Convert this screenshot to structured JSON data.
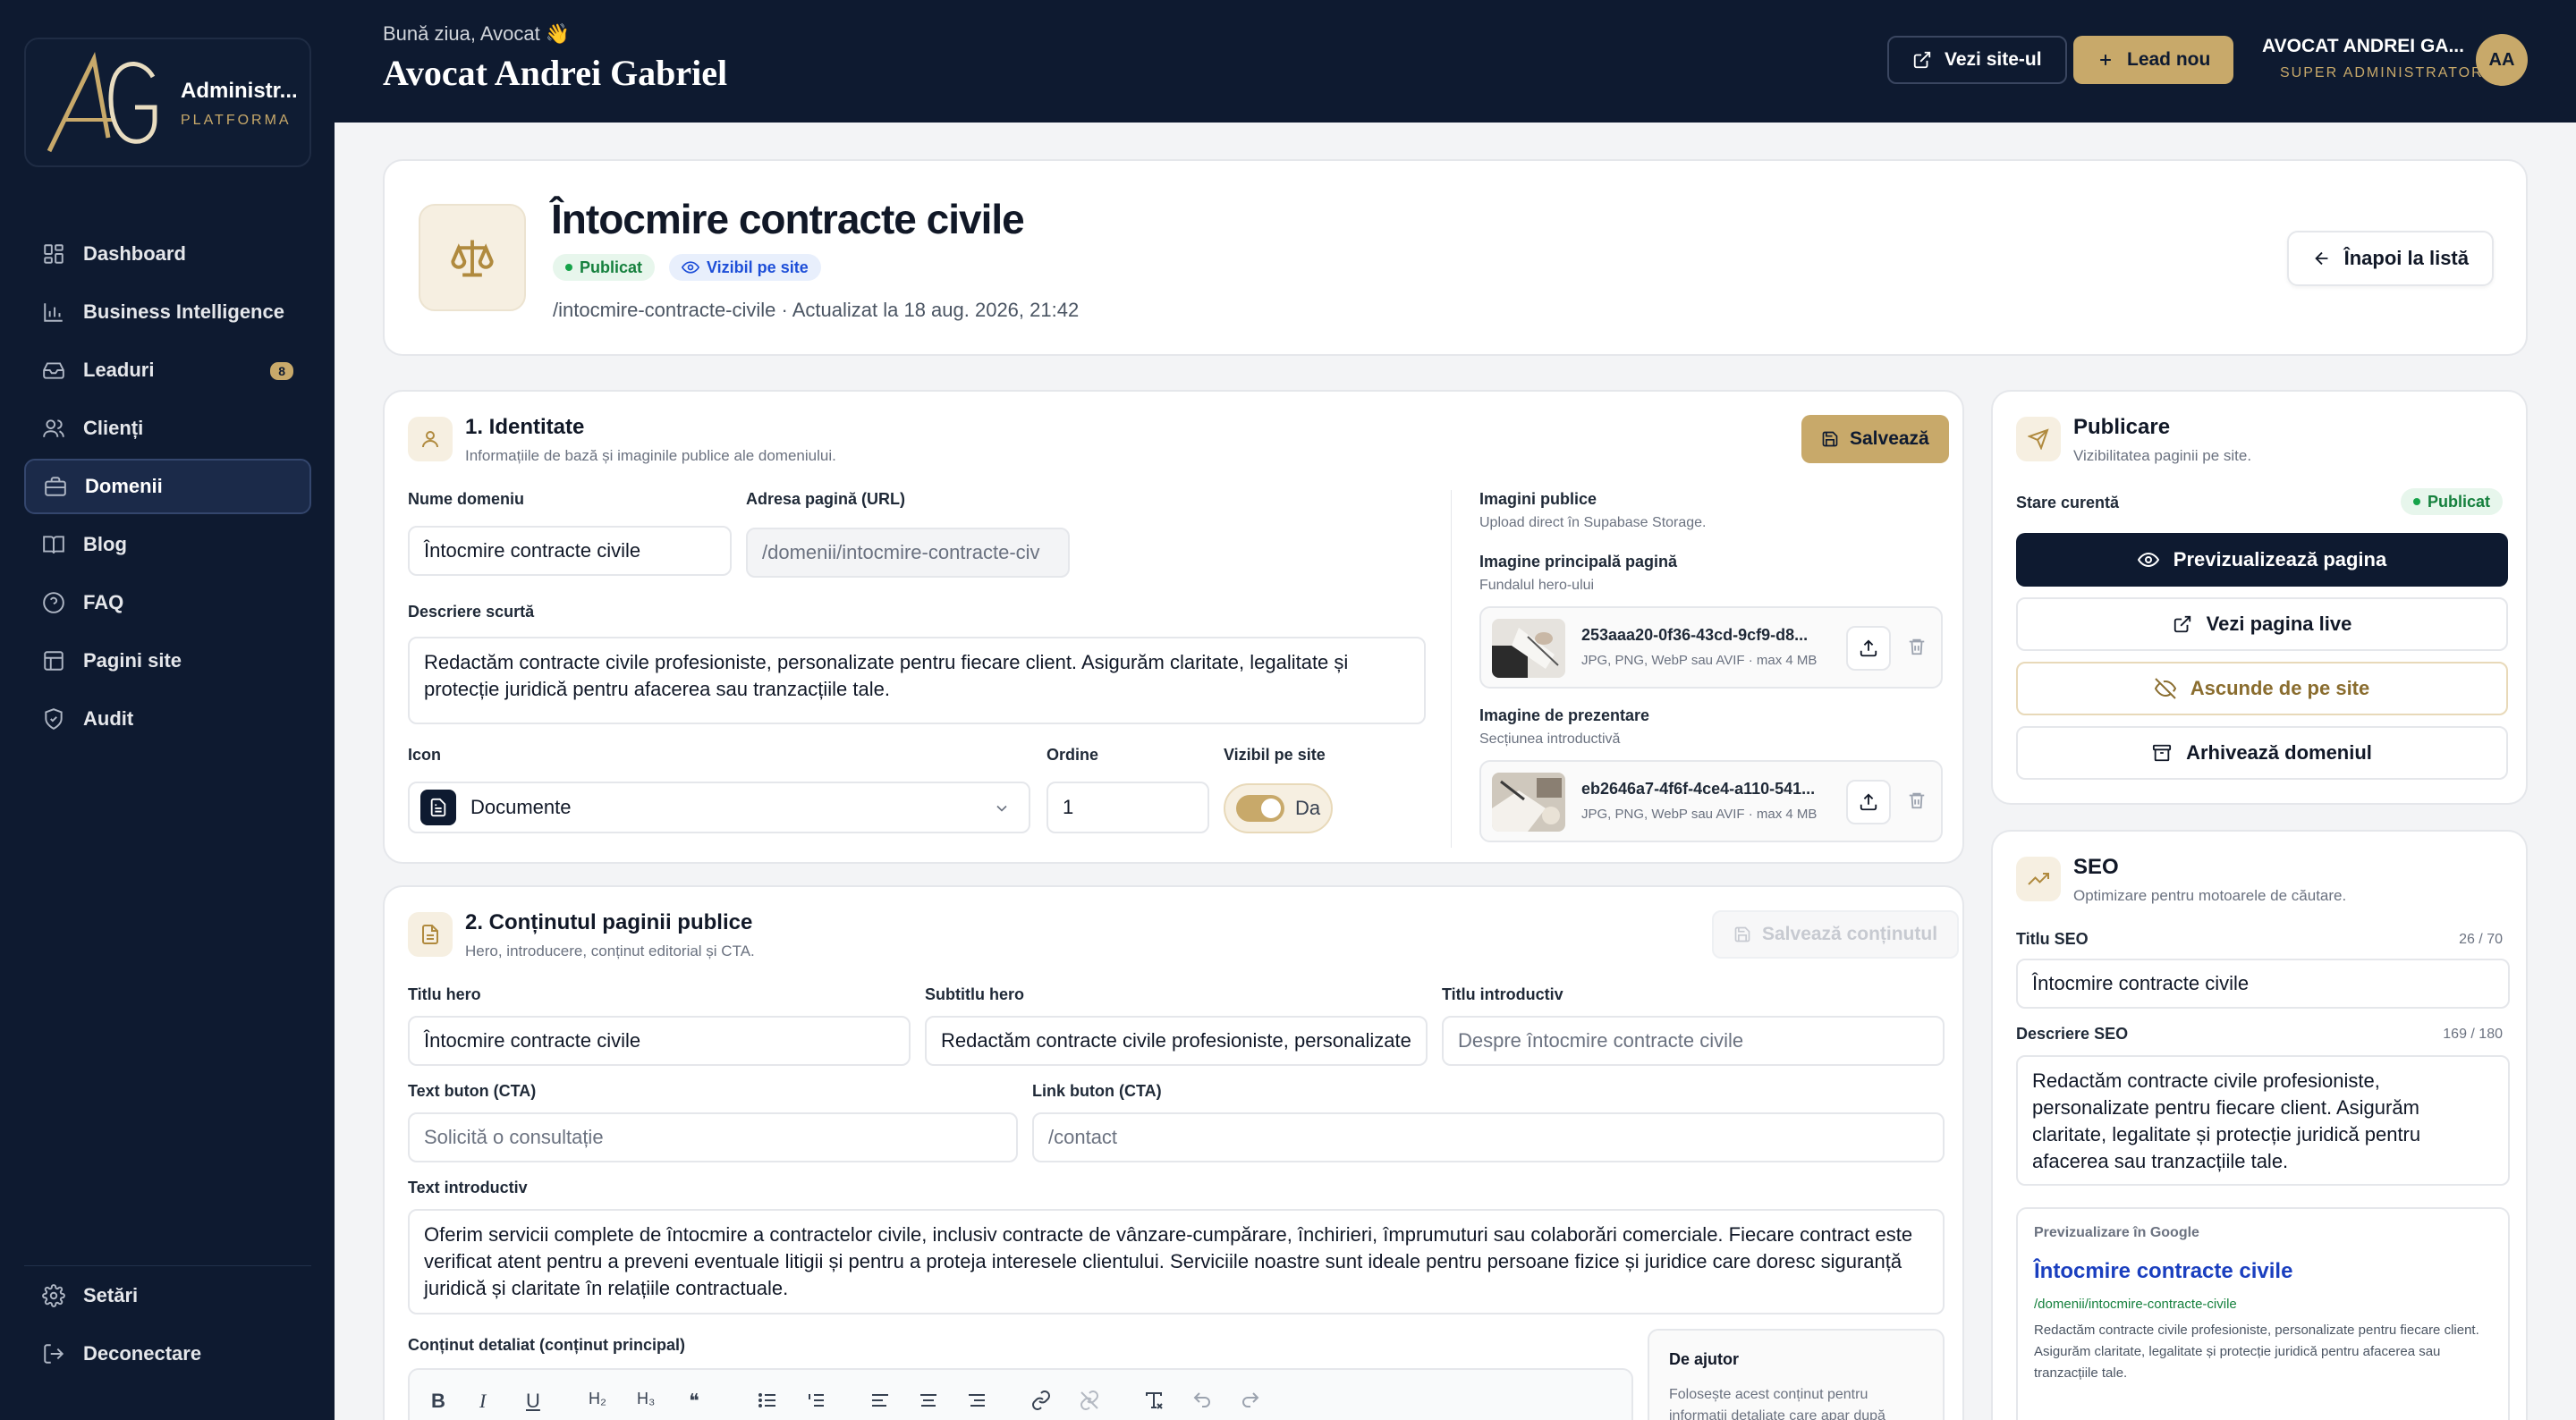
{
  "sidebar": {
    "brand_title": "Administr...",
    "brand_sub": "PLATFORMA",
    "brand_logo_text": "AG",
    "items": [
      {
        "label": "Dashboard",
        "icon": "dashboard-icon"
      },
      {
        "label": "Business Intelligence",
        "icon": "bar-chart-icon"
      },
      {
        "label": "Leaduri",
        "icon": "inbox-icon",
        "badge": "8"
      },
      {
        "label": "Clienți",
        "icon": "users-icon"
      },
      {
        "label": "Domenii",
        "icon": "briefcase-icon",
        "active": true
      },
      {
        "label": "Blog",
        "icon": "book-icon"
      },
      {
        "label": "FAQ",
        "icon": "help-circle-icon"
      },
      {
        "label": "Pagini site",
        "icon": "layout-icon"
      },
      {
        "label": "Audit",
        "icon": "shield-icon"
      }
    ],
    "bottom": [
      {
        "label": "Setări",
        "icon": "gear-icon"
      },
      {
        "label": "Deconectare",
        "icon": "logout-icon"
      }
    ]
  },
  "header": {
    "greeting": "Bună ziua, Avocat 👋",
    "name": "Avocat Andrei Gabriel",
    "view_site": "Vezi site-ul",
    "new_lead": "Lead nou",
    "user_name": "AVOCAT ANDREI GA...",
    "user_role": "SUPER ADMINISTRATOR",
    "avatar": "AA"
  },
  "page": {
    "title": "Întocmire contracte civile",
    "status_published": "Publicat",
    "status_visible": "Vizibil pe site",
    "meta": "/intocmire-contracte-civile · Actualizat la 18 aug. 2026, 21:42",
    "back": "Înapoi la listă"
  },
  "identity": {
    "title": "1. Identitate",
    "subtitle": "Informațiile de bază și imaginile publice ale domeniului.",
    "save": "Salvează",
    "name_label": "Nume domeniu",
    "name_value": "Întocmire contracte civile",
    "url_label": "Adresa pagină (URL)",
    "url_value": "/domenii/intocmire-contracte-civ",
    "desc_label": "Descriere scurtă",
    "desc_value": "Redactăm contracte civile profesioniste, personalizate pentru fiecare client. Asigurăm claritate, legalitate și protecție juridică pentru afacerea sau tranzacțiile tale.",
    "icon_label": "Icon",
    "icon_value": "Documente",
    "order_label": "Ordine",
    "order_value": "1",
    "visible_label": "Vizibil pe site",
    "visible_value": "Da",
    "images_label": "Imagini publice",
    "images_sub": "Upload direct în Supabase Storage.",
    "main_img_label": "Imagine principală pagină",
    "main_img_sub": "Fundalul hero-ului",
    "main_img_file": "253aaa20-0f36-43cd-9cf9-d8...",
    "img_meta": "JPG, PNG, WebP sau AVIF · max 4 MB",
    "pres_img_label": "Imagine de prezentare",
    "pres_img_sub": "Secțiunea introductivă",
    "pres_img_file": "eb2646a7-4f6f-4ce4-a110-541..."
  },
  "content": {
    "title": "2. Conținutul paginii publice",
    "subtitle": "Hero, introducere, conținut editorial și CTA.",
    "save": "Salvează conținutul",
    "hero_title_label": "Titlu hero",
    "hero_title_value": "Întocmire contracte civile",
    "hero_sub_label": "Subtitlu hero",
    "hero_sub_value": "Redactăm contracte civile profesioniste, personalizate",
    "intro_title_label": "Titlu introductiv",
    "intro_title_ph": "Despre întocmire contracte civile",
    "cta_text_label": "Text buton (CTA)",
    "cta_text_ph": "Solicită o consultație",
    "cta_link_label": "Link buton (CTA)",
    "cta_link_ph": "/contact",
    "intro_text_label": "Text introductiv",
    "intro_text_value": "Oferim servicii complete de întocmire a contractelor civile, inclusiv contracte de vânzare-cumpărare, închirieri, împrumuturi sau colaborări comerciale. Fiecare contract este verificat atent pentru a preveni eventuale litigii și pentru a proteja interesele clientului. Serviciile noastre sunt ideale pentru persoane fizice și juridice care doresc siguranță juridică și claritate în relațiile contractuale.",
    "detail_label": "Conținut detaliat (conținut principal)",
    "help_title": "De ajutor",
    "help_text": "Folosește acest conținut pentru informații detaliate care apar după",
    "toolbar": [
      "B",
      "I",
      "U",
      "H₂",
      "H₃",
      "❝",
      "list",
      "olist",
      "left",
      "center",
      "right",
      "link",
      "unlink",
      "clear",
      "undo",
      "redo"
    ]
  },
  "publish": {
    "title": "Publicare",
    "subtitle": "Vizibilitatea paginii pe site.",
    "state_label": "Stare curentă",
    "state_value": "Publicat",
    "preview": "Previzualizează pagina",
    "live": "Vezi pagina live",
    "hide": "Ascunde de pe site",
    "archive": "Arhivează domeniul"
  },
  "seo": {
    "title": "SEO",
    "subtitle": "Optimizare pentru motoarele de căutare.",
    "title_label": "Titlu SEO",
    "title_count": "26 / 70",
    "title_value": "Întocmire contracte civile",
    "desc_label": "Descriere SEO",
    "desc_count": "169 / 180",
    "desc_value": "Redactăm contracte civile profesioniste, personalizate pentru fiecare client. Asigurăm claritate, legalitate și protecție juridică pentru afacerea sau tranzacțiile tale.",
    "google_label": "Previzualizare în Google",
    "google_title": "Întocmire contracte civile",
    "google_url": "/domenii/intocmire-contracte-civile",
    "google_desc": "Redactăm contracte civile profesioniste, personalizate pentru fiecare client. Asigurăm claritate, legalitate și protecție juridică pentru afacerea sau tranzacțiile tale."
  },
  "colors": {
    "navy": "#0e1a30",
    "gold": "#c8a96a",
    "green": "#16a34a",
    "blue": "#1d4ed8"
  }
}
